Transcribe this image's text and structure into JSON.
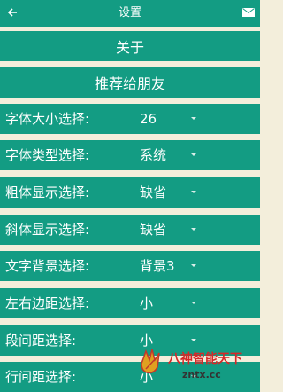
{
  "header": {
    "title": "设置",
    "back_icon": "back-arrow-icon",
    "right_icon": "mail-icon"
  },
  "buttons": {
    "about": "关于",
    "recommend": "推荐给朋友"
  },
  "settings": [
    {
      "label": "字体大小选择:",
      "value": "26"
    },
    {
      "label": "字体类型选择:",
      "value": "系统"
    },
    {
      "label": "粗体显示选择:",
      "value": "缺省"
    },
    {
      "label": "斜体显示选择:",
      "value": "缺省"
    },
    {
      "label": "文字背景选择:",
      "value": "背景3"
    },
    {
      "label": "左右边距选择:",
      "value": "小"
    },
    {
      "label": "段间距选择:",
      "value": "小"
    },
    {
      "label": "行间距选择:",
      "value": "小"
    }
  ],
  "watermark": {
    "text": "八神智能天下",
    "url": "zntx.cc"
  },
  "colors": {
    "accent": "#139c83",
    "background": "#f3eedb"
  }
}
